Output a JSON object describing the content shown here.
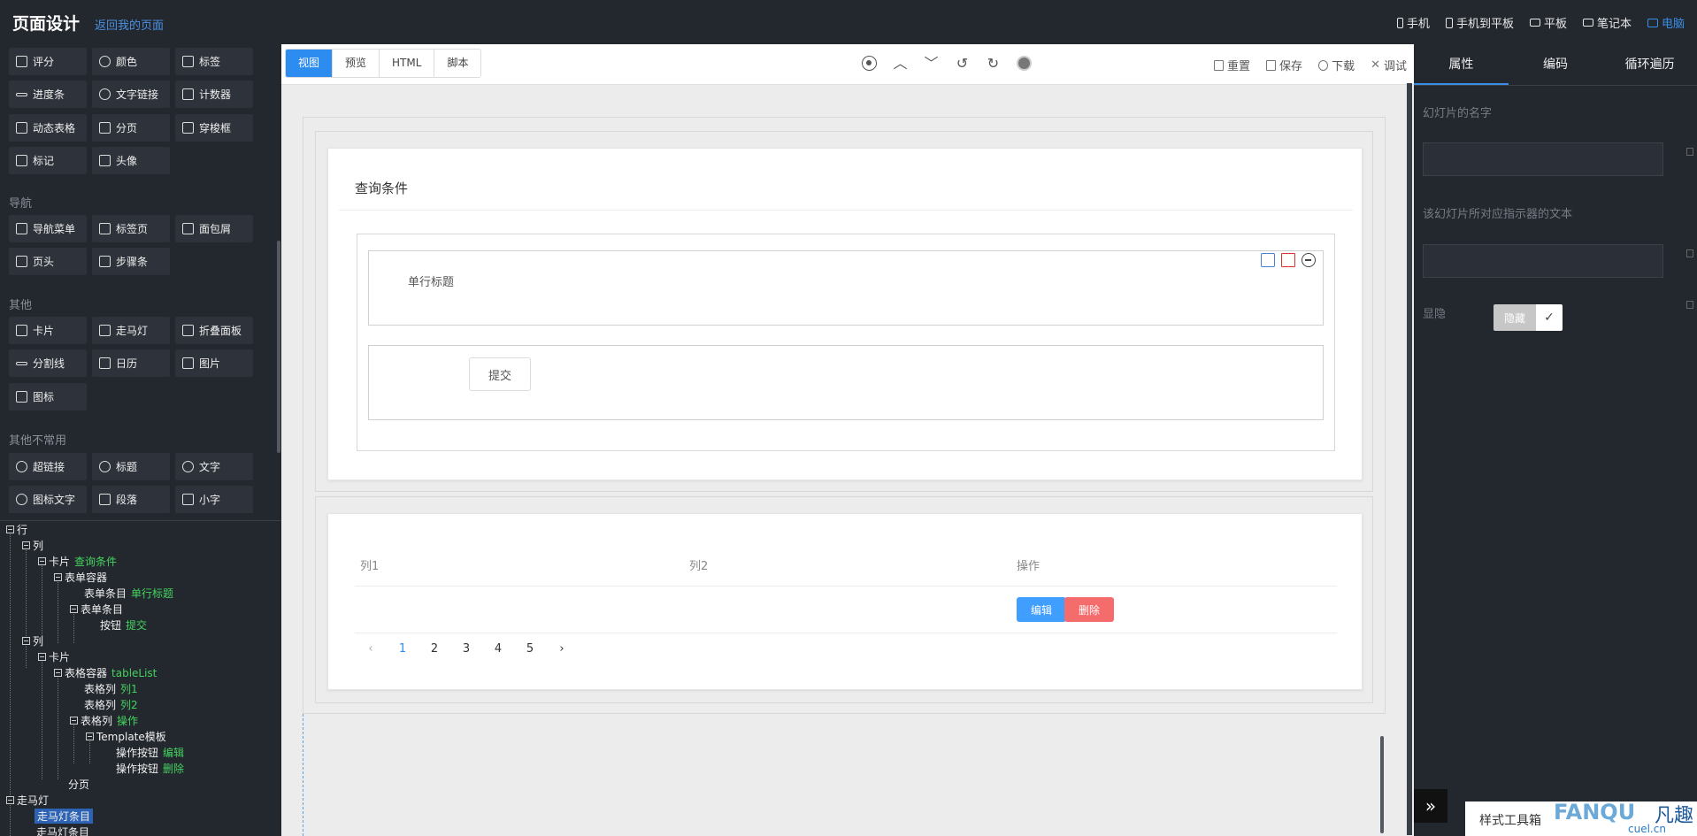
{
  "header": {
    "title": "页面设计",
    "back_link": "返回我的页面",
    "devices": [
      {
        "label": "手机",
        "icon": "phone-icon",
        "active": false
      },
      {
        "label": "手机到平板",
        "icon": "phone-tablet-icon",
        "active": false
      },
      {
        "label": "平板",
        "icon": "tablet-icon",
        "active": false
      },
      {
        "label": "笔记本",
        "icon": "laptop-icon",
        "active": false
      },
      {
        "label": "电脑",
        "icon": "desktop-icon",
        "active": true
      }
    ]
  },
  "palette": {
    "row1": [
      "评分",
      "颜色",
      "标签"
    ],
    "row2": [
      "进度条",
      "文字链接",
      "计数器"
    ],
    "row3": [
      "动态表格",
      "分页",
      "穿梭框"
    ],
    "row4": [
      "标记",
      "头像"
    ],
    "nav_section": "导航",
    "nav1": [
      "导航菜单",
      "标签页",
      "面包屑"
    ],
    "nav2": [
      "页头",
      "步骤条"
    ],
    "other_section": "其他",
    "other1": [
      "卡片",
      "走马灯",
      "折叠面板"
    ],
    "other2": [
      "分割线",
      "日历",
      "图片"
    ],
    "other3": [
      "图标"
    ],
    "rare_section": "其他不常用",
    "rare1": [
      "超链接",
      "标题",
      "文字"
    ],
    "rare2": [
      "图标文字",
      "段落",
      "小字"
    ]
  },
  "tree": [
    {
      "label": "行",
      "sub": ""
    },
    {
      "label": "列",
      "sub": ""
    },
    {
      "label": "卡片",
      "sub": "查询条件"
    },
    {
      "label": "表单容器",
      "sub": ""
    },
    {
      "label": "表单条目",
      "sub": "单行标题"
    },
    {
      "label": "表单条目",
      "sub": ""
    },
    {
      "label": "按钮",
      "sub": "提交"
    },
    {
      "label": "列",
      "sub": ""
    },
    {
      "label": "卡片",
      "sub": ""
    },
    {
      "label": "表格容器",
      "sub": "tableList"
    },
    {
      "label": "表格列",
      "sub": "列1"
    },
    {
      "label": "表格列",
      "sub": "列2"
    },
    {
      "label": "表格列",
      "sub": "操作"
    },
    {
      "label": "Template模板",
      "sub": ""
    },
    {
      "label": "操作按钮",
      "sub": "编辑"
    },
    {
      "label": "操作按钮",
      "sub": "删除"
    },
    {
      "label": "分页",
      "sub": ""
    },
    {
      "label": "走马灯",
      "sub": ""
    },
    {
      "label": "走马灯条目",
      "sub": ""
    },
    {
      "label": "走马灯条目",
      "sub": ""
    }
  ],
  "toolbar": {
    "tabs": [
      "视图",
      "预览",
      "HTML",
      "脚本"
    ],
    "active_tab": "视图",
    "actions": [
      "重置",
      "保存",
      "下载",
      "调试"
    ]
  },
  "canvas": {
    "card_title": "查询条件",
    "form_label": "单行标题",
    "submit_label": "提交",
    "table": {
      "columns": [
        "列1",
        "列2",
        "操作"
      ],
      "edit_label": "编辑",
      "delete_label": "删除",
      "edit_color": "#409eff",
      "delete_color": "#f56c6c"
    },
    "pages": [
      "1",
      "2",
      "3",
      "4",
      "5"
    ],
    "current_page": "1"
  },
  "right_panel": {
    "tabs": [
      "属性",
      "编码",
      "循环遍历"
    ],
    "active_tab": "属性",
    "slide_name_label": "幻灯片的名字",
    "indicator_text_label": "该幻灯片所对应指示器的文本",
    "visibility_label": "显隐",
    "hide_label": "隐藏",
    "style_toolbox_label": "样式工具箱"
  },
  "watermark": {
    "brand": "FANQU",
    "brand_cn": "凡趣",
    "domain": "cuel.cn"
  },
  "colors": {
    "accent": "#2d8cf0",
    "tree_sub": "#44d35e",
    "bg_dark": "#23272e"
  }
}
